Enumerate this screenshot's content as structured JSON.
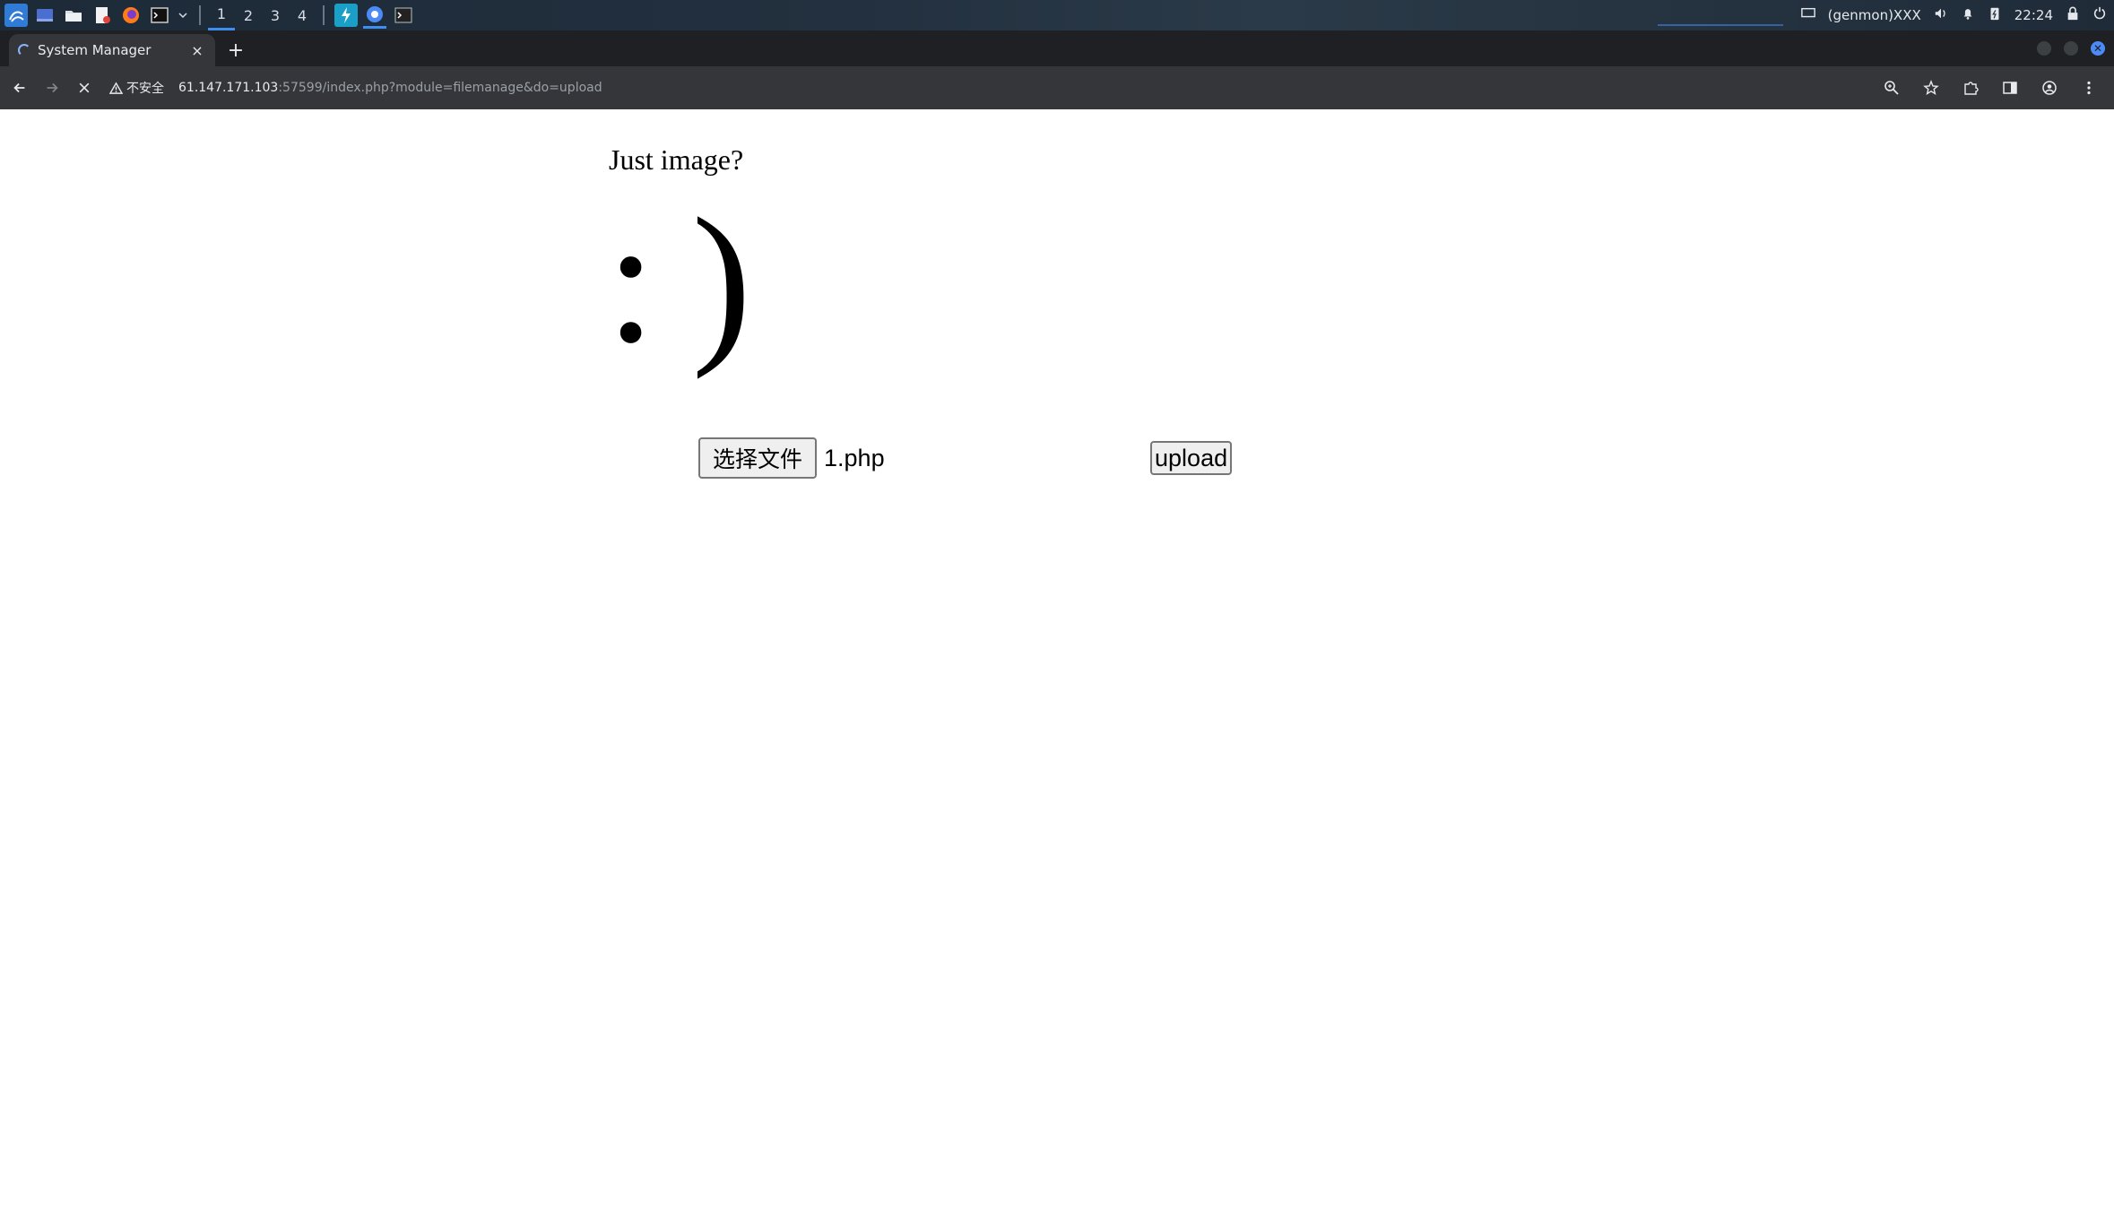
{
  "panel": {
    "workspaces": [
      "1",
      "2",
      "3",
      "4"
    ],
    "active_workspace": "1",
    "genmon": "(genmon)XXX",
    "clock": "22:24",
    "accent": "#3d8ef0"
  },
  "tab": {
    "title": "System Manager",
    "close": "×",
    "new_tab": "+"
  },
  "toolbar": {
    "security_label": "不安全",
    "url_host": "61.147.171.103",
    "url_rest": ":57599/index.php?module=filemanage&do=upload"
  },
  "page": {
    "heading": "Just image?",
    "smiley": ":)",
    "choose_file_label": "选择文件",
    "file_name": "1.php",
    "upload_label": "upload"
  }
}
